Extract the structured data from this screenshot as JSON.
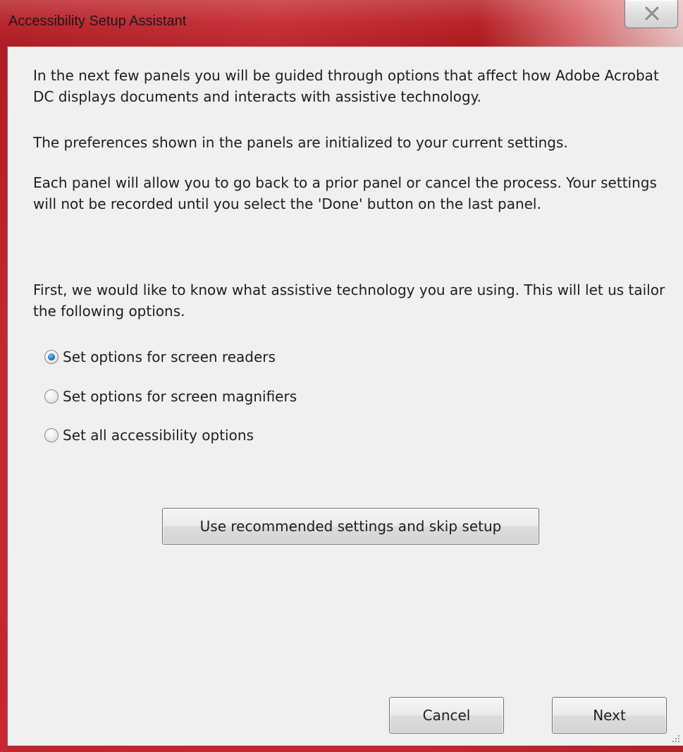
{
  "window": {
    "title": "Accessibility Setup Assistant",
    "close_icon": "close-x-icon"
  },
  "intro": {
    "paragraph1": "In the next few panels you will be guided through options that affect how Adobe Acrobat DC displays documents and interacts with assistive technology.",
    "paragraph2": "The preferences shown in the panels are initialized to your current settings.",
    "paragraph3": "Each panel will allow you to go back to a prior panel or cancel the process. Your settings will not be recorded until you select the 'Done' button on the last panel.",
    "paragraph4": "First, we would like to know what assistive technology you are using. This will let us tailor the following options."
  },
  "options": [
    {
      "label": "Set options for screen readers",
      "checked": true
    },
    {
      "label": "Set options for screen magnifiers",
      "checked": false
    },
    {
      "label": "Set all accessibility options",
      "checked": false
    }
  ],
  "buttons": {
    "skip": "Use recommended settings and skip setup",
    "cancel": "Cancel",
    "next": "Next"
  },
  "colors": {
    "titlebar": "#b51d25",
    "client_bg": "#f0f0f0",
    "radio_selected": "#1f6fb4"
  }
}
